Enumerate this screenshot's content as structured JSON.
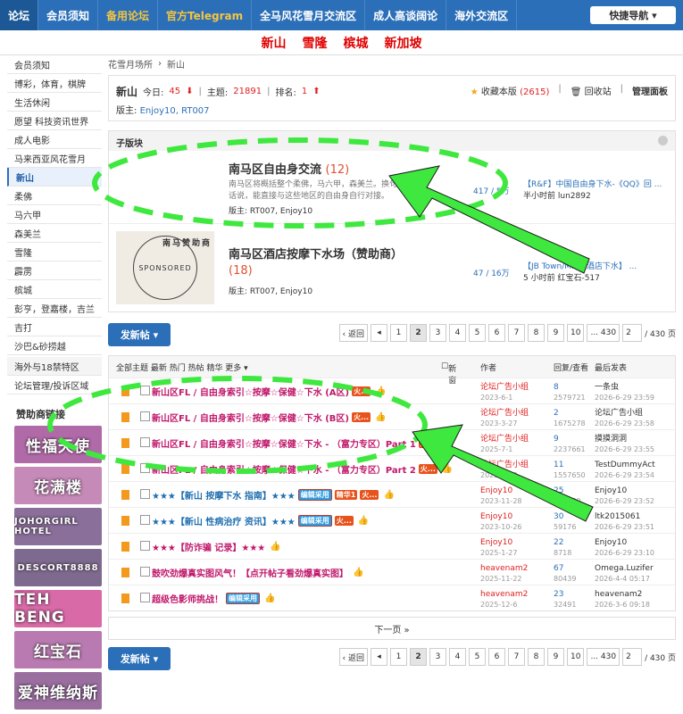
{
  "topnav": {
    "items": [
      {
        "label": "论坛",
        "style": "active"
      },
      {
        "label": "会员须知",
        "style": ""
      },
      {
        "label": "备用论坛",
        "style": "gold"
      },
      {
        "label": "官方Telegram",
        "style": "gold"
      },
      {
        "label": "全马风花雪月交流区",
        "style": ""
      },
      {
        "label": "成人高谈阔论",
        "style": ""
      },
      {
        "label": "海外交流区",
        "style": ""
      }
    ],
    "quick_nav": "快捷导航 ▾"
  },
  "cities": [
    "新山",
    "雪隆",
    "槟城",
    "新加坡"
  ],
  "sidebar": {
    "items": [
      "会员须知",
      "博彩，体育，棋牌",
      "生活休闲",
      "愿望 科技资讯世界",
      "成人电影",
      "马来西亚风花雪月",
      "新山",
      "柔佛",
      "马六甲",
      "森美兰",
      "雪隆",
      "霹雳",
      "槟城",
      "彭亨，登嘉楼，吉兰",
      "吉打",
      "沙巴&砂捞越",
      "海外与18禁特区",
      "论坛管理/投诉区域"
    ],
    "active_index": 6,
    "sponsor_title": "赞助商链接",
    "banners": [
      {
        "text": "性福天使",
        "color": "#b06aa8"
      },
      {
        "text": "花满楼",
        "color": "#c58ab8"
      },
      {
        "text": "JOHORGIRL HOTEL",
        "color": "#8a6f9a"
      },
      {
        "text": "DESCORT8888",
        "color": "#7e6a8e"
      },
      {
        "text": "TEH BENG",
        "color": "#d86aa8"
      },
      {
        "text": "红宝石",
        "color": "#b87ab0"
      },
      {
        "text": "爱神维纳斯",
        "color": "#9a6fa0"
      }
    ]
  },
  "breadcrumb": {
    "home": "花雪月场所",
    "sep": "›",
    "current": "新山"
  },
  "forum": {
    "name": "新山",
    "today_label": "今日:",
    "today": "45",
    "topics_label": "主题:",
    "topics": "21891",
    "rank_label": "排名:",
    "rank": "1",
    "moderators_label": "版主:",
    "moderators": "Enjoy10, RT007",
    "favorite": "收藏本版",
    "favorite_count": "(2615)",
    "recycle": "回收站",
    "manage": "管理面板"
  },
  "subboard": {
    "title": "子版块",
    "boards": [
      {
        "name": "南马区自由身交流",
        "count": "(12)",
        "desc": "南马区将概括整个柔佛，马六甲，森美兰。换句话说，能直接与这些地区的自由身自行对接。",
        "mods": "版主: RT007, Enjoy10",
        "stats": "417 / 5万",
        "last_title": "【R&F】中国自由身下水-《QQ》回 ...",
        "last_time": "半小时前 lun2892"
      },
      {
        "name": "南马区酒店按摩下水场（赞助商）",
        "count": "(18)",
        "desc": "",
        "mods": "版主: RT007, Enjoy10",
        "stats": "47 / 16万",
        "last_title": "【JB Town/M...in酒店下水】 ...",
        "last_time": "5 小时前 红宝石-517",
        "image_text": "SPONSORED",
        "image_caption": "南马赞助商"
      }
    ]
  },
  "actions": {
    "post_button": "发新帖 ▾",
    "pager": [
      "‹ 返回",
      "◂",
      "1",
      "2",
      "3",
      "4",
      "5",
      "6",
      "7",
      "8",
      "9",
      "10",
      "... 430"
    ],
    "current_page": "2",
    "page_input": "2",
    "page_total": "/ 430 页"
  },
  "threads": {
    "header": {
      "filters": "全部主题  最新  热门  热帖  精华  更多 ▾",
      "new_window": "新窗",
      "author": "作者",
      "stats": "回复/查看",
      "last": "最后发表"
    },
    "rows": [
      {
        "title": "新山区FL / 自由身索引☆按摩☆保健☆下水 (A区)",
        "color": "#c0186b",
        "tags": [
          "火..."
        ],
        "author": "论坛广告小组",
        "author_date": "2023-6-1",
        "replies": "8",
        "views": "2579721",
        "last_user": "一条虫",
        "last_time": "2026-6-29 23:59"
      },
      {
        "title": "新山区FL / 自由身索引☆按摩☆保健☆下水 (B区)",
        "color": "#c0186b",
        "tags": [
          "火..."
        ],
        "author": "论坛广告小组",
        "author_date": "2023-3-27",
        "replies": "2",
        "views": "1675278",
        "last_user": "论坛广告小组",
        "last_time": "2026-6-29 23:58"
      },
      {
        "title": "新山区FL / 自由身索引☆按摩☆保健☆下水 - （富力专区）Part 1",
        "color": "#c0186b",
        "tags": [
          "火..."
        ],
        "author": "论坛广告小组",
        "author_date": "2025-7-1",
        "replies": "9",
        "views": "2237661",
        "last_user": "摸摸洞洞",
        "last_time": "2026-6-29 23:55"
      },
      {
        "title": "新山区FL / 自由身索引☆按摩☆保健☆下水 - （富力专区）Part 2",
        "color": "#c0186b",
        "tags": [
          "火..."
        ],
        "author": "论坛广告小组",
        "author_date": "2025-3-30",
        "replies": "11",
        "views": "1557650",
        "last_user": "TestDummyAct",
        "last_time": "2026-6-29 23:54"
      },
      {
        "title": "★★★【新山 按摩下水 指南】★★★",
        "color": "#1f6fb0",
        "tags": [
          "编辑采用",
          "精华1",
          "火..."
        ],
        "author": "Enjoy10",
        "author_date": "2023-11-28",
        "replies": "25",
        "views": "403340",
        "last_user": "Enjoy10",
        "last_time": "2026-6-29 23:52"
      },
      {
        "title": "★★★【新山 性病治疗 资讯】★★★",
        "color": "#1f6fb0",
        "tags": [
          "编辑采用",
          "火..."
        ],
        "author": "Enjoy10",
        "author_date": "2023-10-26",
        "replies": "30",
        "views": "59176",
        "last_user": "ltk2015061",
        "last_time": "2026-6-29 23:51"
      },
      {
        "title": "★★★【防诈骗 记录】★★★",
        "color": "#c0186b",
        "tags": [],
        "author": "Enjoy10",
        "author_date": "2025-1-27",
        "replies": "22",
        "views": "8718",
        "last_user": "Enjoy10",
        "last_time": "2026-6-29 23:10"
      },
      {
        "title": "鼓吹劲爆真实图风气！【点开帖子看劲爆真实图】",
        "color": "#c0186b",
        "tags": [],
        "author": "heavenam2",
        "author_date": "2025-11-22",
        "replies": "67",
        "views": "80439",
        "last_user": "Omega.Luzifer",
        "last_time": "2026-4-4 05:17"
      },
      {
        "title": "超级色影师挑战！",
        "color": "#c0186b",
        "tags": [
          "编辑采用"
        ],
        "author": "heavenam2",
        "author_date": "2025-12-6",
        "replies": "23",
        "views": "32491",
        "last_user": "heavenam2",
        "last_time": "2026-3-6 09:18"
      }
    ],
    "next_page": "下一页 »"
  }
}
